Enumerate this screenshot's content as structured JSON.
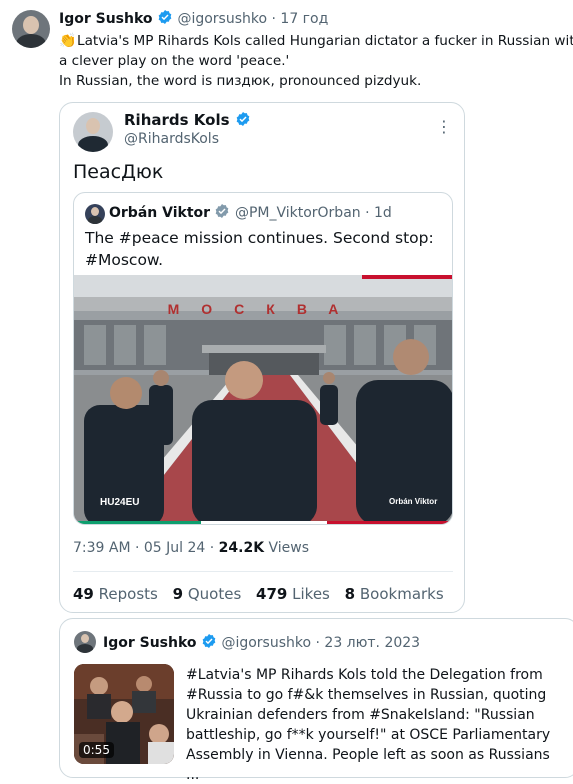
{
  "main_post": {
    "author_name": "Igor Sushko",
    "handle": "@igorsushko",
    "separator": "·",
    "time": "17 год",
    "text_line_1": "Latvia's MP Rihards Kols called Hungarian dictator a fucker in Russian with",
    "text_line_2": "a clever play on the word 'peace.'",
    "text_line_3": "In Russian, the word is пиздюк, pronounced pizdyuk."
  },
  "quoted_post": {
    "author_name": "Rihards Kols",
    "handle": "@RihardsKols",
    "text": "ПеасДюк",
    "timestamp": "7:39 AM · 05 Jul 24 · ",
    "views_count": "24.2K",
    "views_label": " Views",
    "stats": [
      {
        "count": "49",
        "label": "Reposts"
      },
      {
        "count": "9",
        "label": "Quotes"
      },
      {
        "count": "479",
        "label": "Likes"
      },
      {
        "count": "8",
        "label": "Bookmarks"
      }
    ]
  },
  "nested_post": {
    "author_name": "Orbán Viktor",
    "handle": "@PM_ViktorOrban",
    "separator": "·",
    "time": "1d",
    "text": "The #peace mission continues. Second stop: #Moscow.",
    "photo_sign": "МОСКВА",
    "watermark_left": "HU24EU",
    "watermark_right": "Orbán Viktor"
  },
  "second_card": {
    "author_name": "Igor Sushko",
    "handle": "@igorsushko",
    "separator": "·",
    "date": "23 лют. 2023",
    "duration": "0:55",
    "text": "#Latvia's MP Rihards Kols told the Delegation from #Russia to go f#&k themselves in Russian, quoting Ukrainian defenders from #SnakeIsland: \"Russian battleship, go f**k yourself!\" at OSCE Parliamentary Assembly in Vienna. People left as soon as Russians ..."
  },
  "colors": {
    "verified": "#1d9bf0",
    "text": "#0f1419",
    "muted": "#536471",
    "border": "#cfd9de"
  }
}
